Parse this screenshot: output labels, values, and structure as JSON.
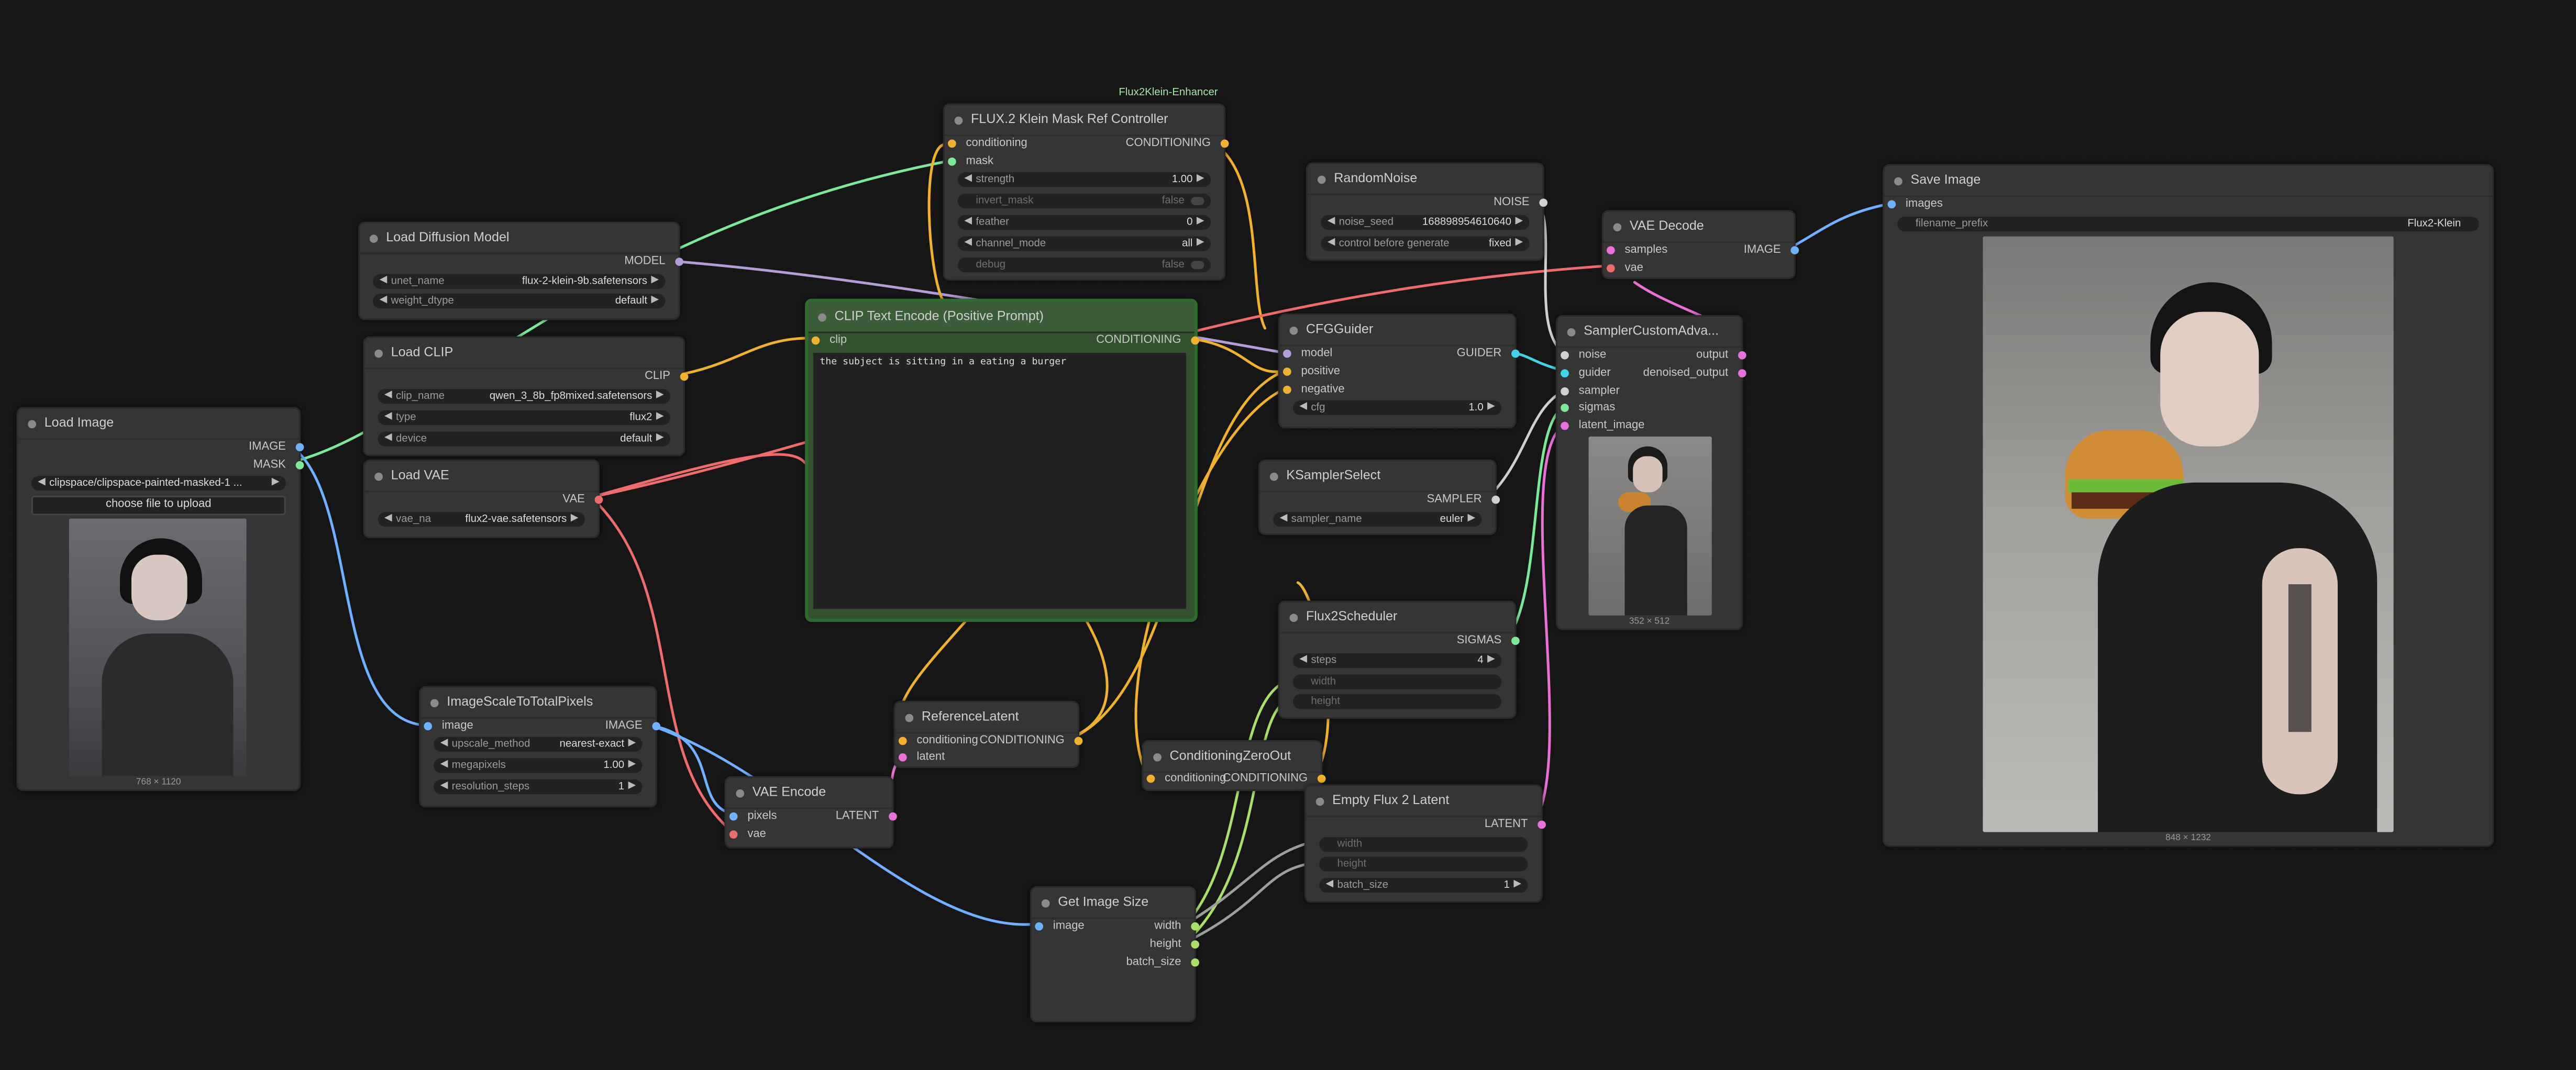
{
  "group_label": "Flux2Klein-Enhancer",
  "nodes": {
    "load_image": {
      "title": "Load Image",
      "out_image": "IMAGE",
      "out_mask": "MASK",
      "image_widget": "clipspace/clipspace-painted-masked-1 ...",
      "upload_button": "choose file to upload",
      "caption": "768 × 1120"
    },
    "load_diffusion_model": {
      "title": "Load Diffusion Model",
      "out_model": "MODEL",
      "unet_name": {
        "label": "unet_name",
        "value": "flux-2-klein-9b.safetensors"
      },
      "weight_dtype": {
        "label": "weight_dtype",
        "value": "default"
      }
    },
    "load_clip": {
      "title": "Load CLIP",
      "out_clip": "CLIP",
      "clip_name": {
        "label": "clip_name",
        "value": "qwen_3_8b_fp8mixed.safetensors"
      },
      "type": {
        "label": "type",
        "value": "flux2"
      },
      "device": {
        "label": "device",
        "value": "default"
      }
    },
    "load_vae": {
      "title": "Load VAE",
      "out_vae": "VAE",
      "vae_name": {
        "label": "vae_na",
        "value": "flux2-vae.safetensors"
      }
    },
    "image_scale": {
      "title": "ImageScaleToTotalPixels",
      "in_image": "image",
      "out_image": "IMAGE",
      "upscale_method": {
        "label": "upscale_method",
        "value": "nearest-exact"
      },
      "megapixels": {
        "label": "megapixels",
        "value": "1.00"
      },
      "resolution_steps": {
        "label": "resolution_steps",
        "value": "1"
      }
    },
    "vae_encode": {
      "title": "VAE Encode",
      "in_pixels": "pixels",
      "in_vae": "vae",
      "out_latent": "LATENT"
    },
    "flux_mask_ref": {
      "title": "FLUX.2 Klein Mask Ref Controller",
      "in_conditioning": "conditioning",
      "in_mask": "mask",
      "out_conditioning": "CONDITIONING",
      "strength": {
        "label": "strength",
        "value": "1.00"
      },
      "invert_mask": {
        "label": "invert_mask",
        "value": "false"
      },
      "feather": {
        "label": "feather",
        "value": "0"
      },
      "channel_mode": {
        "label": "channel_mode",
        "value": "all"
      },
      "debug": {
        "label": "debug",
        "value": "false"
      }
    },
    "clip_text_encode": {
      "title": "CLIP Text Encode (Positive Prompt)",
      "in_clip": "clip",
      "out_conditioning": "CONDITIONING",
      "text": "the subject is sitting in a eating a burger"
    },
    "reference_latent": {
      "title": "ReferenceLatent",
      "in_conditioning": "conditioning",
      "in_latent": "latent",
      "out_conditioning": "CONDITIONING"
    },
    "conditioning_zero_out": {
      "title": "ConditioningZeroOut",
      "in_conditioning": "conditioning",
      "out_conditioning": "CONDITIONING"
    },
    "get_image_size": {
      "title": "Get Image Size",
      "in_image": "image",
      "out_width": "width",
      "out_height": "height",
      "out_batch_size": "batch_size"
    },
    "random_noise": {
      "title": "RandomNoise",
      "out_noise": "NOISE",
      "noise_seed": {
        "label": "noise_seed",
        "value": "168898954610640"
      },
      "control": {
        "label": "control before generate",
        "value": "fixed"
      }
    },
    "cfg_guider": {
      "title": "CFGGuider",
      "in_model": "model",
      "in_positive": "positive",
      "in_negative": "negative",
      "out_guider": "GUIDER",
      "cfg": {
        "label": "cfg",
        "value": "1.0"
      }
    },
    "ksampler_select": {
      "title": "KSamplerSelect",
      "out_sampler": "SAMPLER",
      "sampler_name": {
        "label": "sampler_name",
        "value": "euler"
      }
    },
    "flux2_scheduler": {
      "title": "Flux2Scheduler",
      "out_sigmas": "SIGMAS",
      "steps": {
        "label": "steps",
        "value": "4"
      },
      "width": {
        "label": "width"
      },
      "height": {
        "label": "height"
      }
    },
    "empty_flux2_latent": {
      "title": "Empty Flux 2 Latent",
      "out_latent": "LATENT",
      "width": {
        "label": "width"
      },
      "height": {
        "label": "height"
      },
      "batch_size": {
        "label": "batch_size",
        "value": "1"
      }
    },
    "vae_decode": {
      "title": "VAE Decode",
      "in_samples": "samples",
      "in_vae": "vae",
      "out_image": "IMAGE"
    },
    "sampler_custom": {
      "title": "SamplerCustomAdva...",
      "in_noise": "noise",
      "in_guider": "guider",
      "in_sampler": "sampler",
      "in_sigmas": "sigmas",
      "in_latent_image": "latent_image",
      "out_output": "output",
      "out_denoised_output": "denoised_output",
      "caption": "352 × 512"
    },
    "save_image": {
      "title": "Save Image",
      "in_images": "images",
      "filename_prefix": {
        "label": "filename_prefix",
        "value": "Flux2-Klein"
      },
      "caption": "848 × 1232"
    }
  },
  "colors": {
    "image": "#6fb0ff",
    "mask": "#7ee89a",
    "model": "#b39ddb",
    "clip": "#f0b030",
    "conditioning": "#f0b030",
    "vae": "#ee6c6c",
    "latent": "#e870d6",
    "int": "#a8e06a",
    "noise": "#d0d0d0",
    "guider": "#43d3e8",
    "sampler": "#d0d0d0",
    "sigmas": "#7ee89a",
    "canvas_bg": "#161616",
    "node_bg": "#353535",
    "clip_node_bg": "#33512e"
  },
  "icons": [
    "node-collapse-dot",
    "arrow-left-icon",
    "arrow-right-icon",
    "toggle-icon"
  ]
}
